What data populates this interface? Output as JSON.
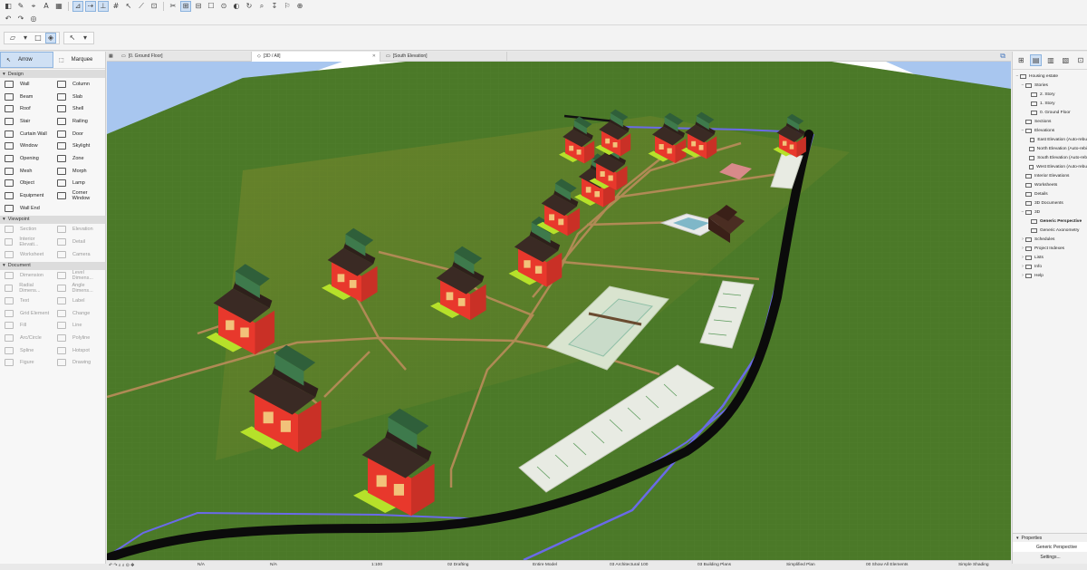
{
  "toolbox": {
    "arrow_label": "Arrow",
    "marquee_label": "Marquee",
    "design_section": "Design",
    "design_tools": [
      "Wall",
      "Column",
      "Beam",
      "Slab",
      "Roof",
      "Shell",
      "Stair",
      "Railing",
      "Curtain Wall",
      "Door",
      "Window",
      "Skylight",
      "Opening",
      "Zone",
      "Mesh",
      "Morph",
      "Object",
      "Lamp",
      "Equipment",
      "Corner Window",
      "Wall End"
    ],
    "viewpoint_section": "Viewpoint",
    "viewpoint_tools": [
      "Section",
      "Elevation",
      "Interior Elevati...",
      "Detail",
      "Worksheet",
      "Camera"
    ],
    "document_section": "Document",
    "document_tools": [
      "Dimension",
      "Level Dimens...",
      "Radial Dimens...",
      "Angle Dimens...",
      "Text",
      "Label",
      "Grid Element",
      "Change",
      "Fill",
      "Line",
      "Arc/Circle",
      "Polyline",
      "Spline",
      "Hotspot",
      "Figure",
      "Drawing"
    ]
  },
  "tabs": [
    {
      "label": "[0. Ground Floor]"
    },
    {
      "label": "[3D / All]"
    },
    {
      "label": "[South Elevation]"
    }
  ],
  "navigator": {
    "items": [
      {
        "label": "Housing estate",
        "indent": 0,
        "toggle": "−"
      },
      {
        "label": "Stories",
        "indent": 1,
        "toggle": "−"
      },
      {
        "label": "2. Story",
        "indent": 2,
        "toggle": ""
      },
      {
        "label": "1. Story",
        "indent": 2,
        "toggle": ""
      },
      {
        "label": "0. Ground Floor",
        "indent": 2,
        "toggle": ""
      },
      {
        "label": "Sections",
        "indent": 1,
        "toggle": ""
      },
      {
        "label": "Elevations",
        "indent": 1,
        "toggle": "−"
      },
      {
        "label": "East Elevation (Auto-rebu",
        "indent": 2,
        "toggle": ""
      },
      {
        "label": "North Elevation (Auto-rebi",
        "indent": 2,
        "toggle": ""
      },
      {
        "label": "South Elevation (Auto-reb",
        "indent": 2,
        "toggle": ""
      },
      {
        "label": "West Elevation (Auto-rebu",
        "indent": 2,
        "toggle": ""
      },
      {
        "label": "Interior Elevations",
        "indent": 1,
        "toggle": ""
      },
      {
        "label": "Worksheets",
        "indent": 1,
        "toggle": ""
      },
      {
        "label": "Details",
        "indent": 1,
        "toggle": ""
      },
      {
        "label": "3D Documents",
        "indent": 1,
        "toggle": ""
      },
      {
        "label": "3D",
        "indent": 1,
        "toggle": "−"
      },
      {
        "label": "Generic Perspective",
        "indent": 2,
        "toggle": "",
        "selected": true
      },
      {
        "label": "Generic Axonometry",
        "indent": 2,
        "toggle": ""
      },
      {
        "label": "Schedules",
        "indent": 1,
        "toggle": "›"
      },
      {
        "label": "Project Indexes",
        "indent": 1,
        "toggle": "›"
      },
      {
        "label": "Lists",
        "indent": 1,
        "toggle": "›"
      },
      {
        "label": "Info",
        "indent": 1,
        "toggle": "›"
      },
      {
        "label": "Help",
        "indent": 1,
        "toggle": "›"
      }
    ],
    "properties_label": "Properties",
    "properties_value": "Generic Perspective",
    "settings_label": "Settings..."
  },
  "status_bar": {
    "na1": "N/A",
    "na2": "N/A",
    "scale": "1:100",
    "layer_combo": "02 Drafting",
    "model_view": "Entire Model",
    "pen_set": "03 Architectural 100",
    "view_map": "03 Building Plans",
    "structure": "Simplified Plan",
    "renovation": "00 Show All Elements",
    "shading": "Simple Shading"
  },
  "colors": {
    "terrain": "#4b7a2a",
    "road": "#111111",
    "path": "#b08a55",
    "house_wall": "#e8382c",
    "boundary": "#6a6ae8",
    "accent": "#cfe0f4"
  }
}
